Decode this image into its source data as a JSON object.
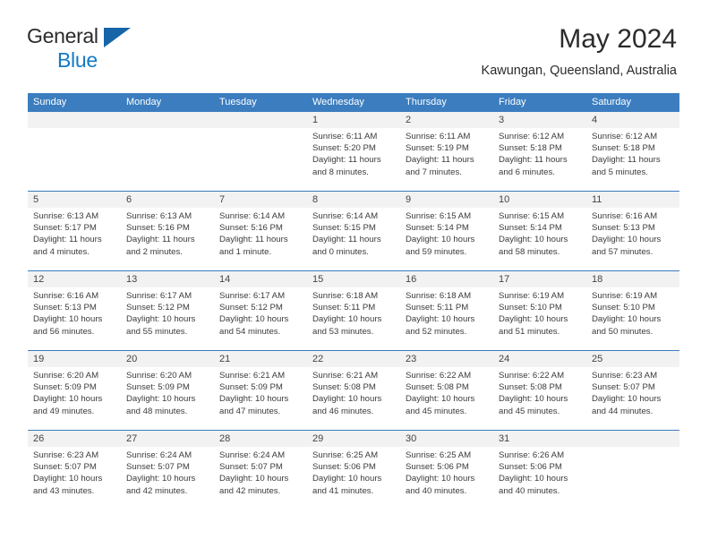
{
  "brand": {
    "name_top": "General",
    "name_bottom": "Blue",
    "triangle_color": "#1565a8",
    "blue_color": "#1479c4"
  },
  "header": {
    "title": "May 2024",
    "subtitle": "Kawungan, Queensland, Australia"
  },
  "theme": {
    "header_blue": "#3b7dbf",
    "daynum_band": "#f2f2f2",
    "text": "#3b3b3b"
  },
  "weekdays": [
    "Sunday",
    "Monday",
    "Tuesday",
    "Wednesday",
    "Thursday",
    "Friday",
    "Saturday"
  ],
  "weeks": [
    [
      {
        "day": "",
        "sunrise": "",
        "sunset": "",
        "daylight": "",
        "daylight2": ""
      },
      {
        "day": "",
        "sunrise": "",
        "sunset": "",
        "daylight": "",
        "daylight2": ""
      },
      {
        "day": "",
        "sunrise": "",
        "sunset": "",
        "daylight": "",
        "daylight2": ""
      },
      {
        "day": "1",
        "sunrise": "Sunrise: 6:11 AM",
        "sunset": "Sunset: 5:20 PM",
        "daylight": "Daylight: 11 hours",
        "daylight2": "and 8 minutes."
      },
      {
        "day": "2",
        "sunrise": "Sunrise: 6:11 AM",
        "sunset": "Sunset: 5:19 PM",
        "daylight": "Daylight: 11 hours",
        "daylight2": "and 7 minutes."
      },
      {
        "day": "3",
        "sunrise": "Sunrise: 6:12 AM",
        "sunset": "Sunset: 5:18 PM",
        "daylight": "Daylight: 11 hours",
        "daylight2": "and 6 minutes."
      },
      {
        "day": "4",
        "sunrise": "Sunrise: 6:12 AM",
        "sunset": "Sunset: 5:18 PM",
        "daylight": "Daylight: 11 hours",
        "daylight2": "and 5 minutes."
      }
    ],
    [
      {
        "day": "5",
        "sunrise": "Sunrise: 6:13 AM",
        "sunset": "Sunset: 5:17 PM",
        "daylight": "Daylight: 11 hours",
        "daylight2": "and 4 minutes."
      },
      {
        "day": "6",
        "sunrise": "Sunrise: 6:13 AM",
        "sunset": "Sunset: 5:16 PM",
        "daylight": "Daylight: 11 hours",
        "daylight2": "and 2 minutes."
      },
      {
        "day": "7",
        "sunrise": "Sunrise: 6:14 AM",
        "sunset": "Sunset: 5:16 PM",
        "daylight": "Daylight: 11 hours",
        "daylight2": "and 1 minute."
      },
      {
        "day": "8",
        "sunrise": "Sunrise: 6:14 AM",
        "sunset": "Sunset: 5:15 PM",
        "daylight": "Daylight: 11 hours",
        "daylight2": "and 0 minutes."
      },
      {
        "day": "9",
        "sunrise": "Sunrise: 6:15 AM",
        "sunset": "Sunset: 5:14 PM",
        "daylight": "Daylight: 10 hours",
        "daylight2": "and 59 minutes."
      },
      {
        "day": "10",
        "sunrise": "Sunrise: 6:15 AM",
        "sunset": "Sunset: 5:14 PM",
        "daylight": "Daylight: 10 hours",
        "daylight2": "and 58 minutes."
      },
      {
        "day": "11",
        "sunrise": "Sunrise: 6:16 AM",
        "sunset": "Sunset: 5:13 PM",
        "daylight": "Daylight: 10 hours",
        "daylight2": "and 57 minutes."
      }
    ],
    [
      {
        "day": "12",
        "sunrise": "Sunrise: 6:16 AM",
        "sunset": "Sunset: 5:13 PM",
        "daylight": "Daylight: 10 hours",
        "daylight2": "and 56 minutes."
      },
      {
        "day": "13",
        "sunrise": "Sunrise: 6:17 AM",
        "sunset": "Sunset: 5:12 PM",
        "daylight": "Daylight: 10 hours",
        "daylight2": "and 55 minutes."
      },
      {
        "day": "14",
        "sunrise": "Sunrise: 6:17 AM",
        "sunset": "Sunset: 5:12 PM",
        "daylight": "Daylight: 10 hours",
        "daylight2": "and 54 minutes."
      },
      {
        "day": "15",
        "sunrise": "Sunrise: 6:18 AM",
        "sunset": "Sunset: 5:11 PM",
        "daylight": "Daylight: 10 hours",
        "daylight2": "and 53 minutes."
      },
      {
        "day": "16",
        "sunrise": "Sunrise: 6:18 AM",
        "sunset": "Sunset: 5:11 PM",
        "daylight": "Daylight: 10 hours",
        "daylight2": "and 52 minutes."
      },
      {
        "day": "17",
        "sunrise": "Sunrise: 6:19 AM",
        "sunset": "Sunset: 5:10 PM",
        "daylight": "Daylight: 10 hours",
        "daylight2": "and 51 minutes."
      },
      {
        "day": "18",
        "sunrise": "Sunrise: 6:19 AM",
        "sunset": "Sunset: 5:10 PM",
        "daylight": "Daylight: 10 hours",
        "daylight2": "and 50 minutes."
      }
    ],
    [
      {
        "day": "19",
        "sunrise": "Sunrise: 6:20 AM",
        "sunset": "Sunset: 5:09 PM",
        "daylight": "Daylight: 10 hours",
        "daylight2": "and 49 minutes."
      },
      {
        "day": "20",
        "sunrise": "Sunrise: 6:20 AM",
        "sunset": "Sunset: 5:09 PM",
        "daylight": "Daylight: 10 hours",
        "daylight2": "and 48 minutes."
      },
      {
        "day": "21",
        "sunrise": "Sunrise: 6:21 AM",
        "sunset": "Sunset: 5:09 PM",
        "daylight": "Daylight: 10 hours",
        "daylight2": "and 47 minutes."
      },
      {
        "day": "22",
        "sunrise": "Sunrise: 6:21 AM",
        "sunset": "Sunset: 5:08 PM",
        "daylight": "Daylight: 10 hours",
        "daylight2": "and 46 minutes."
      },
      {
        "day": "23",
        "sunrise": "Sunrise: 6:22 AM",
        "sunset": "Sunset: 5:08 PM",
        "daylight": "Daylight: 10 hours",
        "daylight2": "and 45 minutes."
      },
      {
        "day": "24",
        "sunrise": "Sunrise: 6:22 AM",
        "sunset": "Sunset: 5:08 PM",
        "daylight": "Daylight: 10 hours",
        "daylight2": "and 45 minutes."
      },
      {
        "day": "25",
        "sunrise": "Sunrise: 6:23 AM",
        "sunset": "Sunset: 5:07 PM",
        "daylight": "Daylight: 10 hours",
        "daylight2": "and 44 minutes."
      }
    ],
    [
      {
        "day": "26",
        "sunrise": "Sunrise: 6:23 AM",
        "sunset": "Sunset: 5:07 PM",
        "daylight": "Daylight: 10 hours",
        "daylight2": "and 43 minutes."
      },
      {
        "day": "27",
        "sunrise": "Sunrise: 6:24 AM",
        "sunset": "Sunset: 5:07 PM",
        "daylight": "Daylight: 10 hours",
        "daylight2": "and 42 minutes."
      },
      {
        "day": "28",
        "sunrise": "Sunrise: 6:24 AM",
        "sunset": "Sunset: 5:07 PM",
        "daylight": "Daylight: 10 hours",
        "daylight2": "and 42 minutes."
      },
      {
        "day": "29",
        "sunrise": "Sunrise: 6:25 AM",
        "sunset": "Sunset: 5:06 PM",
        "daylight": "Daylight: 10 hours",
        "daylight2": "and 41 minutes."
      },
      {
        "day": "30",
        "sunrise": "Sunrise: 6:25 AM",
        "sunset": "Sunset: 5:06 PM",
        "daylight": "Daylight: 10 hours",
        "daylight2": "and 40 minutes."
      },
      {
        "day": "31",
        "sunrise": "Sunrise: 6:26 AM",
        "sunset": "Sunset: 5:06 PM",
        "daylight": "Daylight: 10 hours",
        "daylight2": "and 40 minutes."
      },
      {
        "day": "",
        "sunrise": "",
        "sunset": "",
        "daylight": "",
        "daylight2": ""
      }
    ]
  ]
}
